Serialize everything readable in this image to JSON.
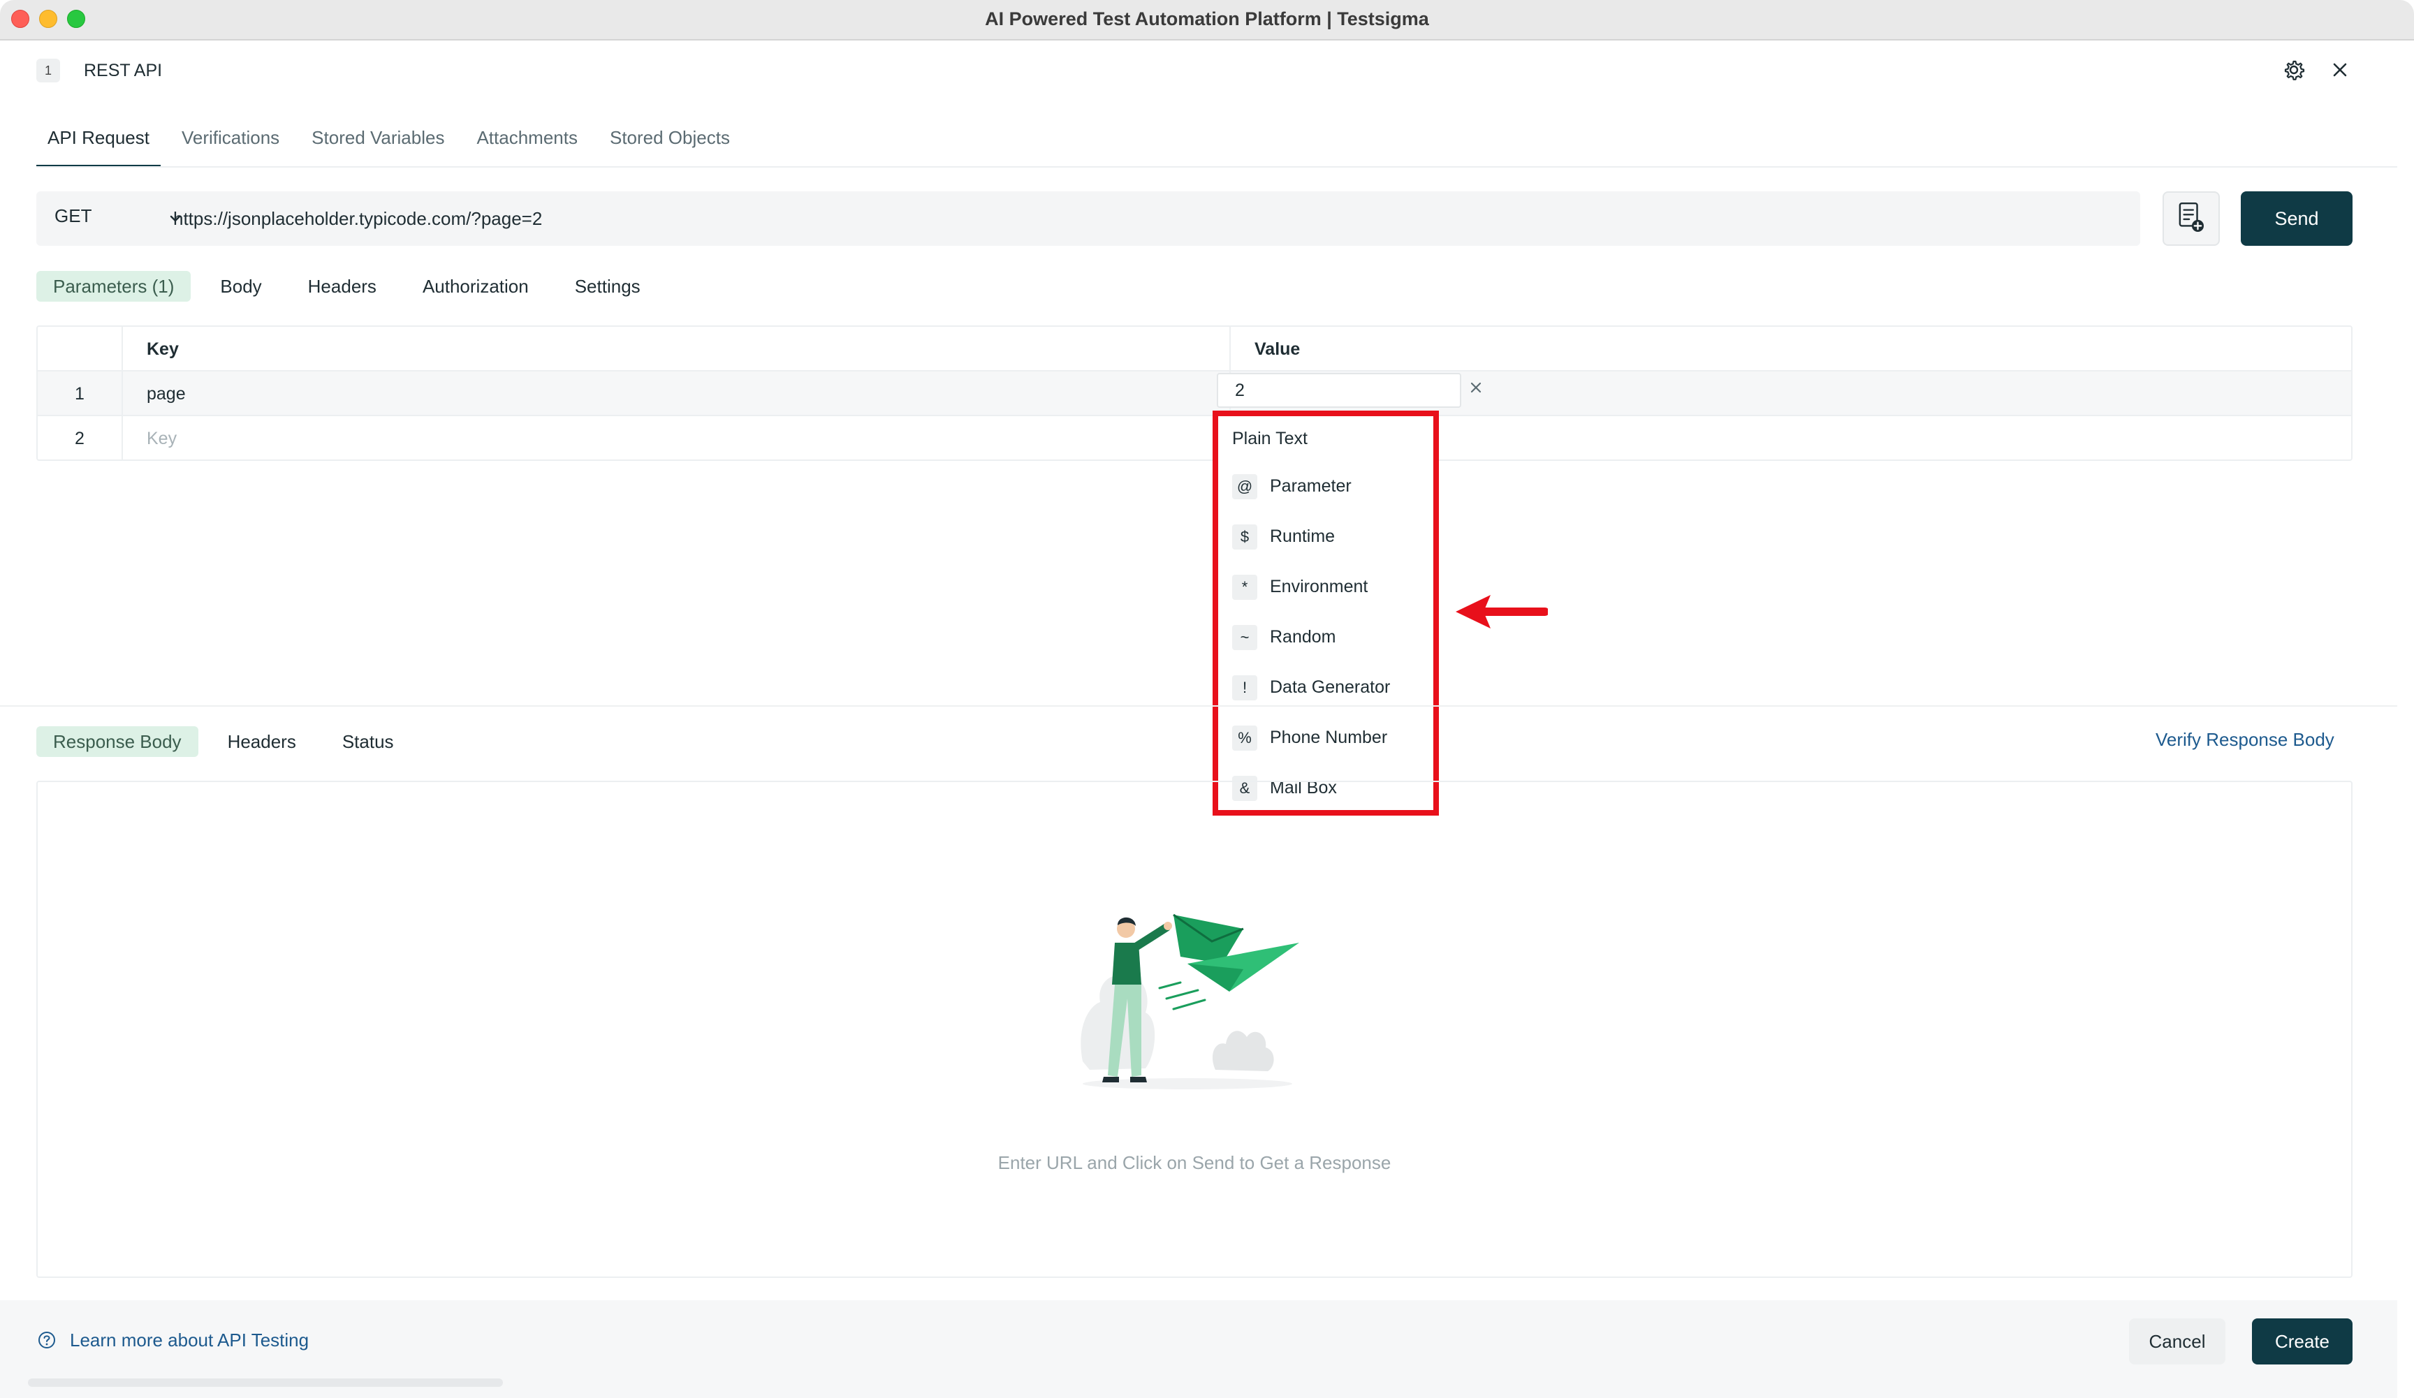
{
  "window": {
    "title": "AI Powered Test Automation Platform | Testsigma"
  },
  "dialog": {
    "step_number": "1",
    "title": "REST API"
  },
  "main_tabs": [
    {
      "label": "API Request",
      "active": true
    },
    {
      "label": "Verifications"
    },
    {
      "label": "Stored Variables"
    },
    {
      "label": "Attachments"
    },
    {
      "label": "Stored Objects"
    }
  ],
  "request": {
    "method": "GET",
    "url": "https://jsonplaceholder.typicode.com/?page=2",
    "send_label": "Send"
  },
  "sub_tabs": [
    {
      "label": "Parameters (1)",
      "active": true
    },
    {
      "label": "Body"
    },
    {
      "label": "Headers"
    },
    {
      "label": "Authorization"
    },
    {
      "label": "Settings"
    }
  ],
  "params_table": {
    "columns": [
      "Key",
      "Value"
    ],
    "rows": [
      {
        "index": "1",
        "key": "page",
        "value": "2"
      },
      {
        "index": "2",
        "key_placeholder": "Key"
      }
    ]
  },
  "value_type_menu": {
    "header": "Plain Text",
    "items": [
      {
        "symbol": "@",
        "label": "Parameter"
      },
      {
        "symbol": "$",
        "label": "Runtime"
      },
      {
        "symbol": "*",
        "label": "Environment"
      },
      {
        "symbol": "~",
        "label": "Random"
      },
      {
        "symbol": "!",
        "label": "Data Generator"
      },
      {
        "symbol": "%",
        "label": "Phone Number"
      },
      {
        "symbol": "&",
        "label": "Mail Box"
      }
    ]
  },
  "response": {
    "tabs": [
      {
        "label": "Response Body",
        "active": true
      },
      {
        "label": "Headers"
      },
      {
        "label": "Status"
      }
    ],
    "verify_link": "Verify Response Body",
    "empty_message": "Enter URL and Click on Send to Get a Response"
  },
  "footer": {
    "help_link": "Learn more about API Testing",
    "cancel_label": "Cancel",
    "create_label": "Create"
  },
  "colors": {
    "primary": "#0f3a45",
    "active_tab_bg": "#ddf1e6",
    "link": "#1d5a8e",
    "highlight": "#e8101b",
    "illustration_green": "#1a9e5c"
  }
}
